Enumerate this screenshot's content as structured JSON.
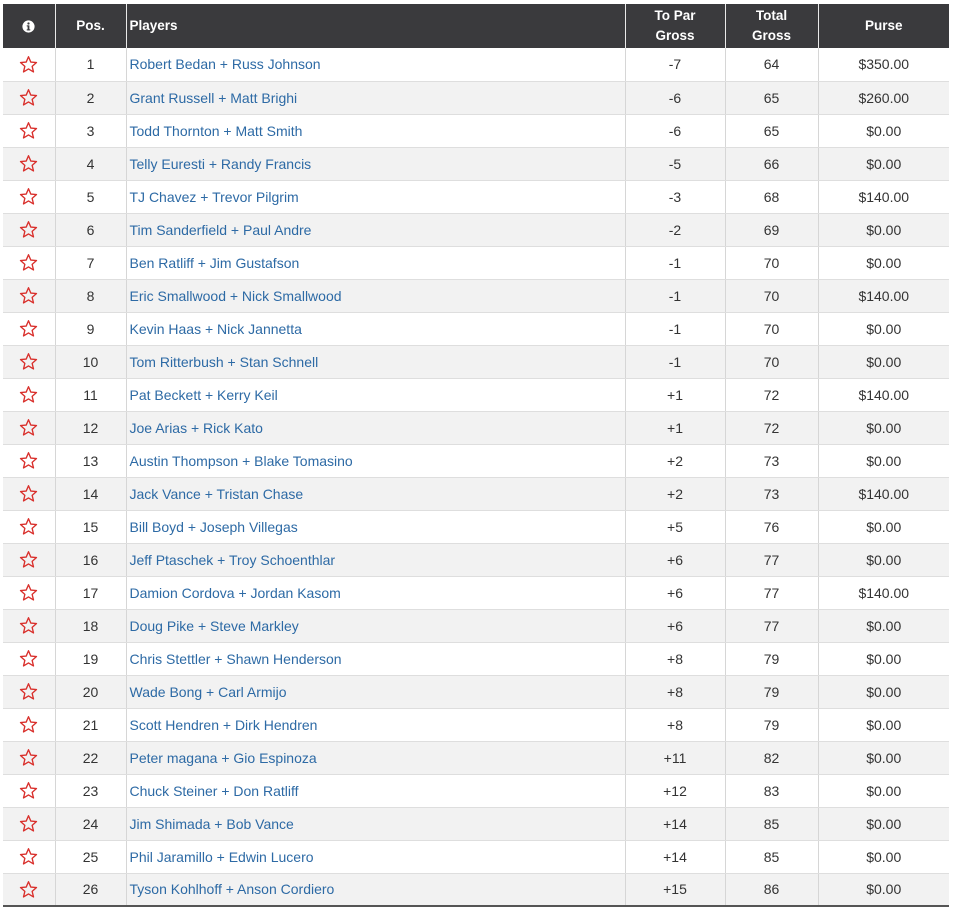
{
  "table": {
    "headers": {
      "info_icon": "info-circle-icon",
      "pos": "Pos.",
      "players": "Players",
      "to_par_line1": "To Par",
      "to_par_line2": "Gross",
      "total_line1": "Total",
      "total_line2": "Gross",
      "purse": "Purse"
    },
    "rows": [
      {
        "pos": "1",
        "players": "Robert Bedan + Russ Johnson",
        "to_par": "-7",
        "total": "64",
        "purse": "$350.00"
      },
      {
        "pos": "2",
        "players": "Grant Russell + Matt Brighi",
        "to_par": "-6",
        "total": "65",
        "purse": "$260.00"
      },
      {
        "pos": "3",
        "players": "Todd Thornton + Matt Smith",
        "to_par": "-6",
        "total": "65",
        "purse": "$0.00"
      },
      {
        "pos": "4",
        "players": "Telly Euresti + Randy Francis",
        "to_par": "-5",
        "total": "66",
        "purse": "$0.00"
      },
      {
        "pos": "5",
        "players": "TJ Chavez + Trevor Pilgrim",
        "to_par": "-3",
        "total": "68",
        "purse": "$140.00"
      },
      {
        "pos": "6",
        "players": "Tim Sanderfield + Paul Andre",
        "to_par": "-2",
        "total": "69",
        "purse": "$0.00"
      },
      {
        "pos": "7",
        "players": "Ben Ratliff + Jim Gustafson",
        "to_par": "-1",
        "total": "70",
        "purse": "$0.00"
      },
      {
        "pos": "8",
        "players": "Eric Smallwood + Nick Smallwood",
        "to_par": "-1",
        "total": "70",
        "purse": "$140.00"
      },
      {
        "pos": "9",
        "players": "Kevin Haas + Nick Jannetta",
        "to_par": "-1",
        "total": "70",
        "purse": "$0.00"
      },
      {
        "pos": "10",
        "players": "Tom Ritterbush + Stan Schnell",
        "to_par": "-1",
        "total": "70",
        "purse": "$0.00"
      },
      {
        "pos": "11",
        "players": "Pat Beckett + Kerry Keil",
        "to_par": "+1",
        "total": "72",
        "purse": "$140.00"
      },
      {
        "pos": "12",
        "players": "Joe Arias + Rick Kato",
        "to_par": "+1",
        "total": "72",
        "purse": "$0.00"
      },
      {
        "pos": "13",
        "players": "Austin Thompson + Blake Tomasino",
        "to_par": "+2",
        "total": "73",
        "purse": "$0.00"
      },
      {
        "pos": "14",
        "players": "Jack Vance + Tristan Chase",
        "to_par": "+2",
        "total": "73",
        "purse": "$140.00"
      },
      {
        "pos": "15",
        "players": "Bill Boyd + Joseph Villegas",
        "to_par": "+5",
        "total": "76",
        "purse": "$0.00"
      },
      {
        "pos": "16",
        "players": "Jeff Ptaschek + Troy Schoenthlar",
        "to_par": "+6",
        "total": "77",
        "purse": "$0.00"
      },
      {
        "pos": "17",
        "players": "Damion Cordova + Jordan Kasom",
        "to_par": "+6",
        "total": "77",
        "purse": "$140.00"
      },
      {
        "pos": "18",
        "players": "Doug Pike + Steve Markley",
        "to_par": "+6",
        "total": "77",
        "purse": "$0.00"
      },
      {
        "pos": "19",
        "players": "Chris Stettler + Shawn Henderson",
        "to_par": "+8",
        "total": "79",
        "purse": "$0.00"
      },
      {
        "pos": "20",
        "players": "Wade Bong + Carl Armijo",
        "to_par": "+8",
        "total": "79",
        "purse": "$0.00"
      },
      {
        "pos": "21",
        "players": "Scott Hendren + Dirk Hendren",
        "to_par": "+8",
        "total": "79",
        "purse": "$0.00"
      },
      {
        "pos": "22",
        "players": "Peter magana + Gio Espinoza",
        "to_par": "+11",
        "total": "82",
        "purse": "$0.00"
      },
      {
        "pos": "23",
        "players": "Chuck Steiner + Don Ratliff",
        "to_par": "+12",
        "total": "83",
        "purse": "$0.00"
      },
      {
        "pos": "24",
        "players": "Jim Shimada + Bob Vance",
        "to_par": "+14",
        "total": "85",
        "purse": "$0.00"
      },
      {
        "pos": "25",
        "players": "Phil Jaramillo + Edwin Lucero",
        "to_par": "+14",
        "total": "85",
        "purse": "$0.00"
      },
      {
        "pos": "26",
        "players": "Tyson Kohlhoff + Anson Cordiero",
        "to_par": "+15",
        "total": "86",
        "purse": "$0.00"
      }
    ],
    "favorite_icon": "star-outline-icon"
  },
  "colors": {
    "header_bg": "#3a3a3d",
    "link": "#2d6aa5",
    "star": "#d9302c",
    "row_alt": "#f2f2f2"
  }
}
